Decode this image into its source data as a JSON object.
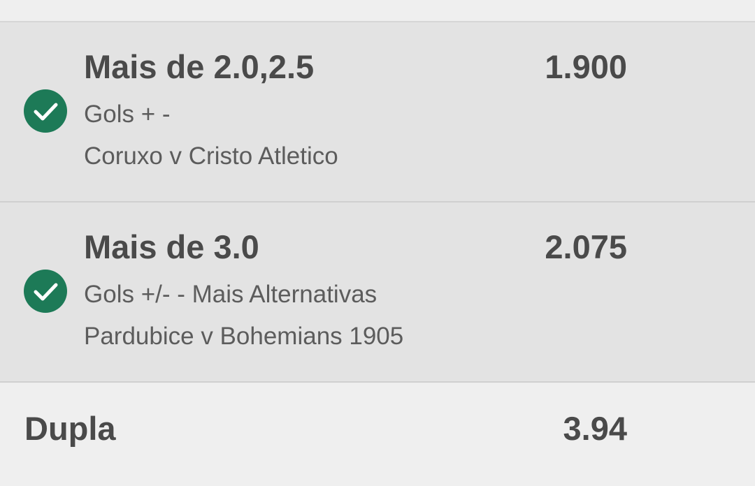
{
  "selections": [
    {
      "title": "Mais de 2.0,2.5",
      "odds": "1.900",
      "market": "Gols + -",
      "event": "Coruxo v Cristo Atletico",
      "status_icon": "check-circle-icon"
    },
    {
      "title": "Mais de 3.0",
      "odds": "2.075",
      "market": "Gols +/- - Mais Alternativas",
      "event": "Pardubice v Bohemians 1905",
      "status_icon": "check-circle-icon"
    }
  ],
  "summary": {
    "label": "Dupla",
    "value": "3.94"
  },
  "colors": {
    "check_green": "#1d7a57",
    "row_background": "#e3e3e3",
    "page_background": "#efefef",
    "text_dark": "#4a4a4a",
    "text_muted": "#5c5c5c"
  }
}
